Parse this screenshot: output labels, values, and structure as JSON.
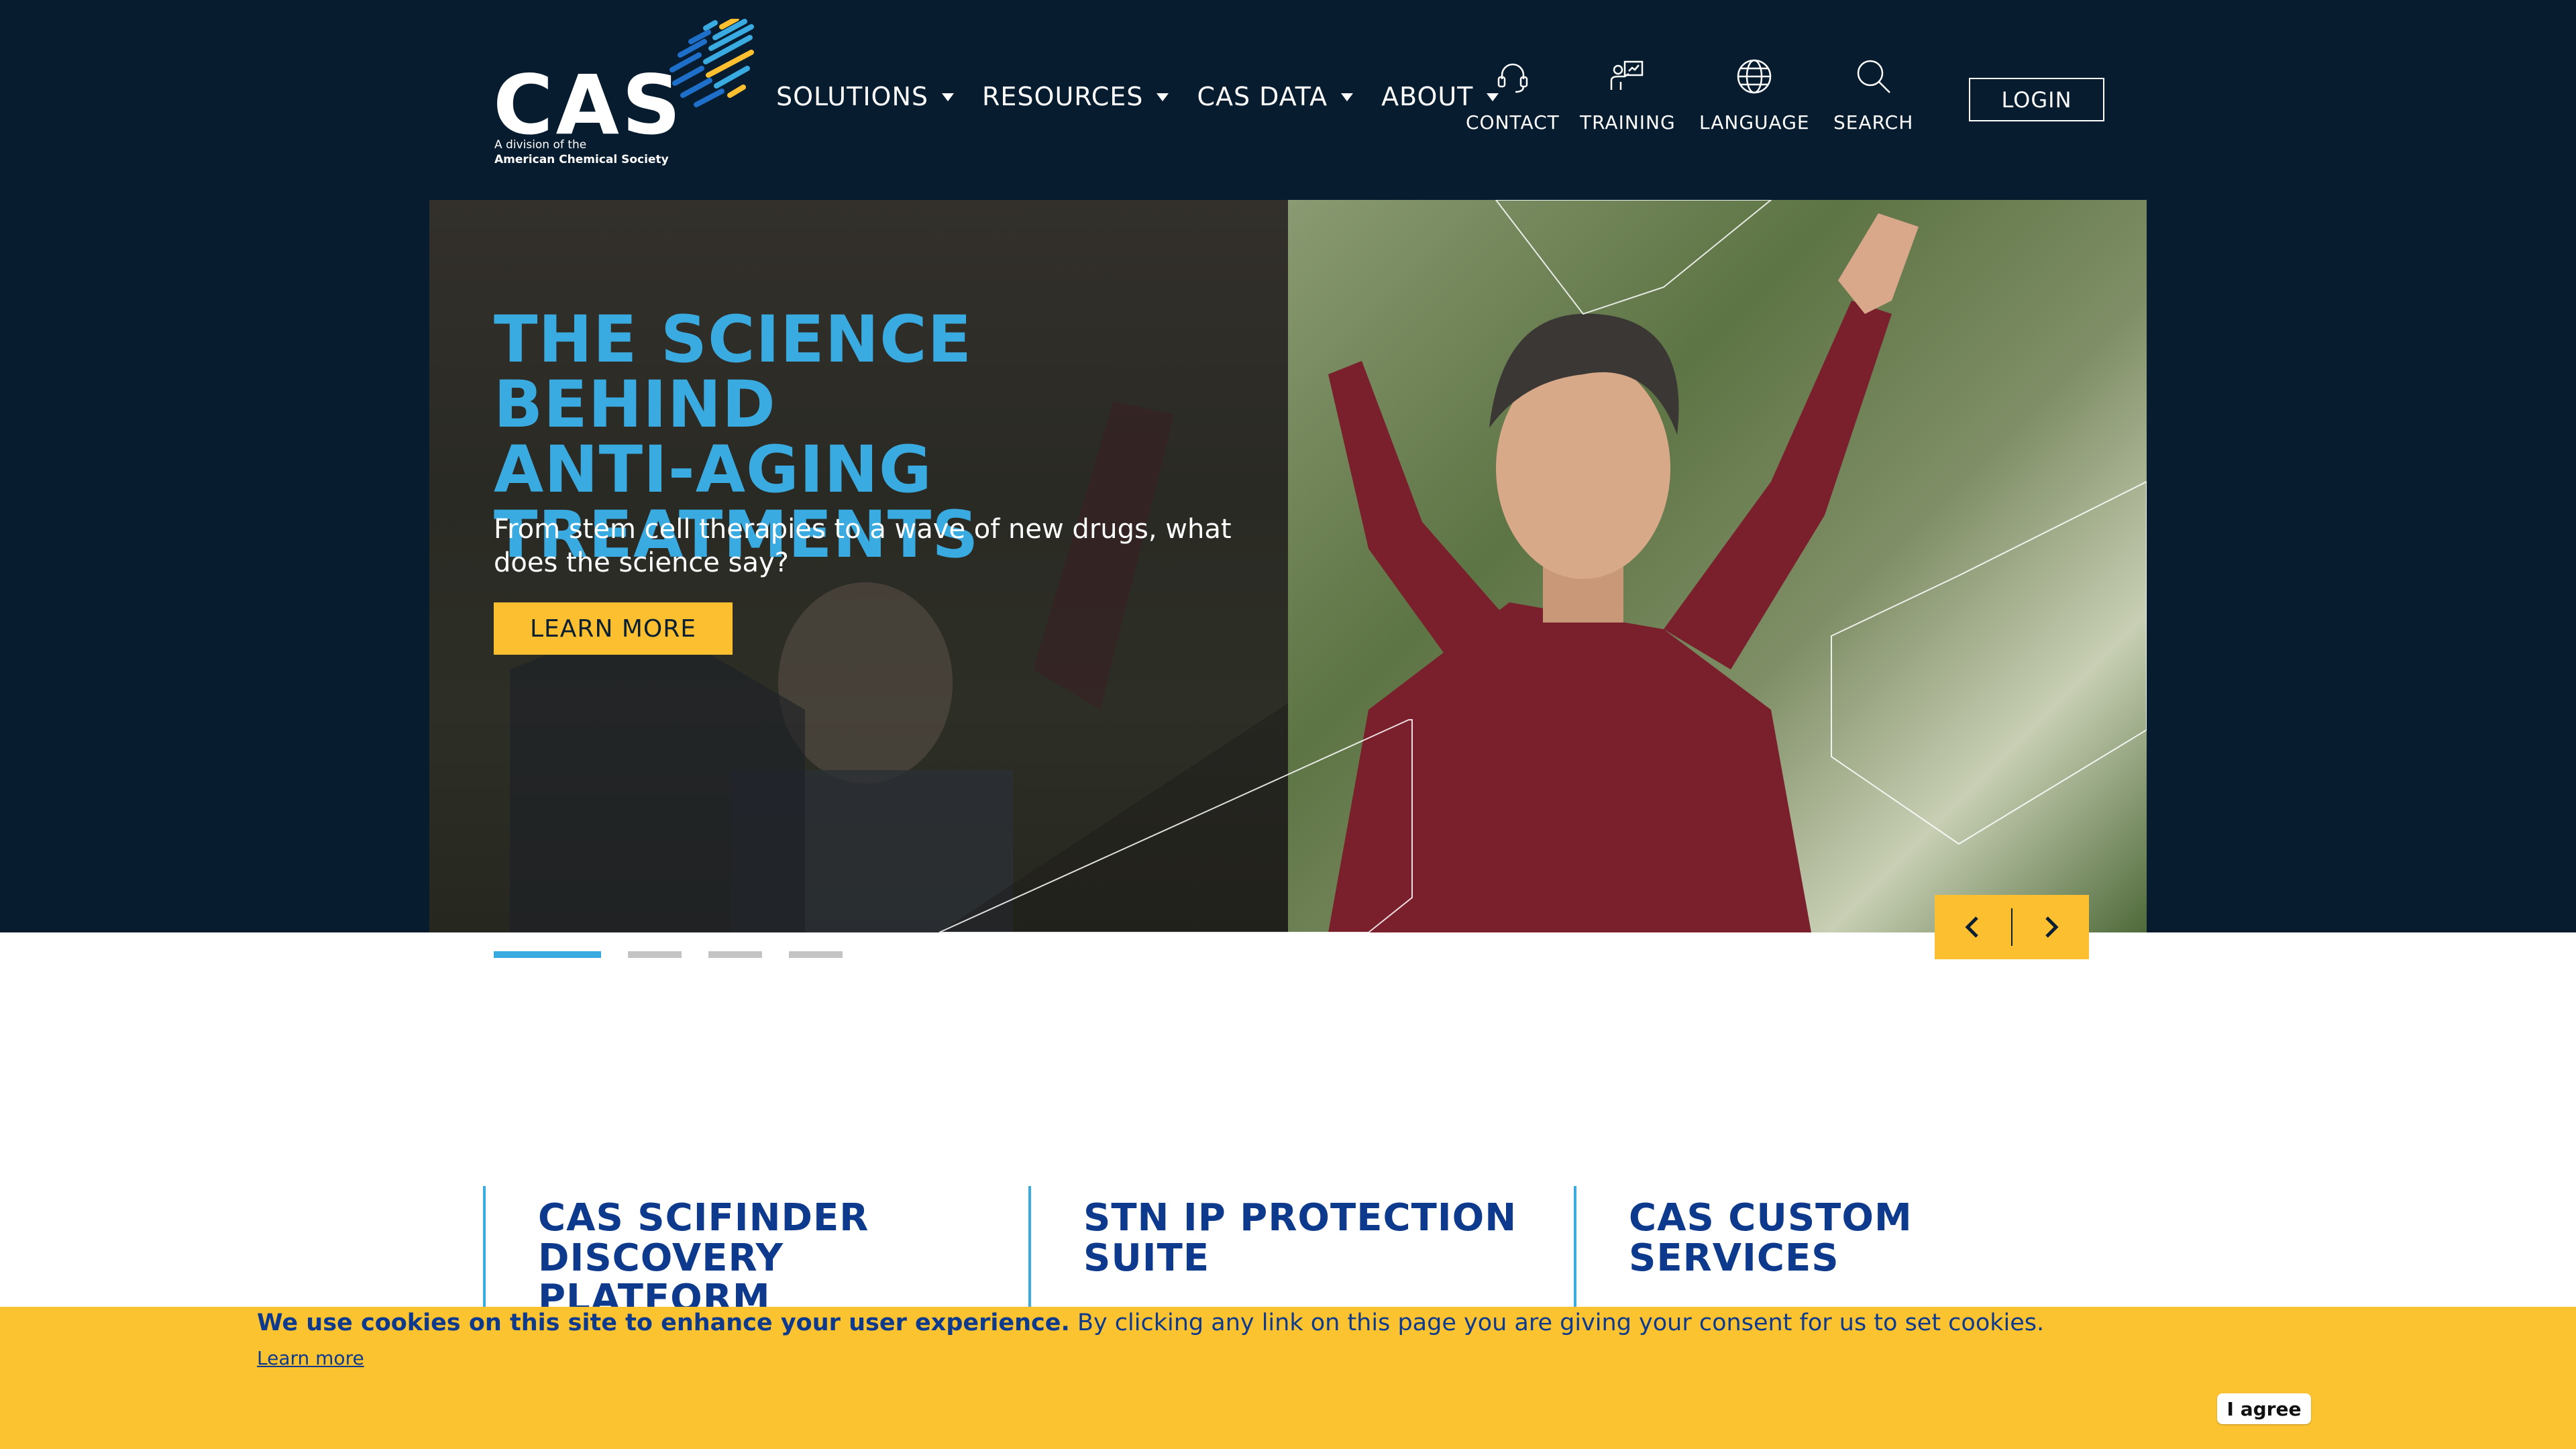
{
  "brand": {
    "logo_text": "CAS",
    "logo_sub1": "A division of the",
    "logo_sub2": "American Chemical Society"
  },
  "nav": {
    "items": [
      {
        "label": "SOLUTIONS"
      },
      {
        "label": "RESOURCES"
      },
      {
        "label": "CAS DATA"
      },
      {
        "label": "ABOUT"
      }
    ]
  },
  "utility": {
    "contact": "CONTACT",
    "training": "TRAINING",
    "language": "LANGUAGE",
    "search": "SEARCH",
    "login": "LOGIN"
  },
  "hero": {
    "title_line1": "THE SCIENCE BEHIND",
    "title_line2": "ANTI-AGING",
    "title_line3": "TREATMENTS",
    "subtitle": "From stem cell therapies to a wave of new drugs, what does the science say?",
    "cta": "LEARN MORE",
    "slide_count": 4,
    "active_slide": 1
  },
  "products": [
    {
      "title": "CAS SCIFINDER DISCOVERY PLATFORM"
    },
    {
      "title": "STN IP PROTECTION SUITE"
    },
    {
      "title": "CAS CUSTOM SERVICES"
    }
  ],
  "cookie": {
    "bold_text": "We use cookies on this site to enhance your user experience.",
    "text": " By clicking any link on this page you are giving your consent for us to set cookies.",
    "learn_more": "Learn more",
    "agree": "I agree"
  },
  "colors": {
    "header_bg": "#071c2e",
    "accent_blue": "#3aabe1",
    "accent_yellow": "#fcbf2f",
    "product_title": "#0d3a8c"
  },
  "icons": [
    "headset-icon",
    "training-icon",
    "globe-icon",
    "search-icon",
    "chevron-left-icon",
    "chevron-right-icon"
  ]
}
